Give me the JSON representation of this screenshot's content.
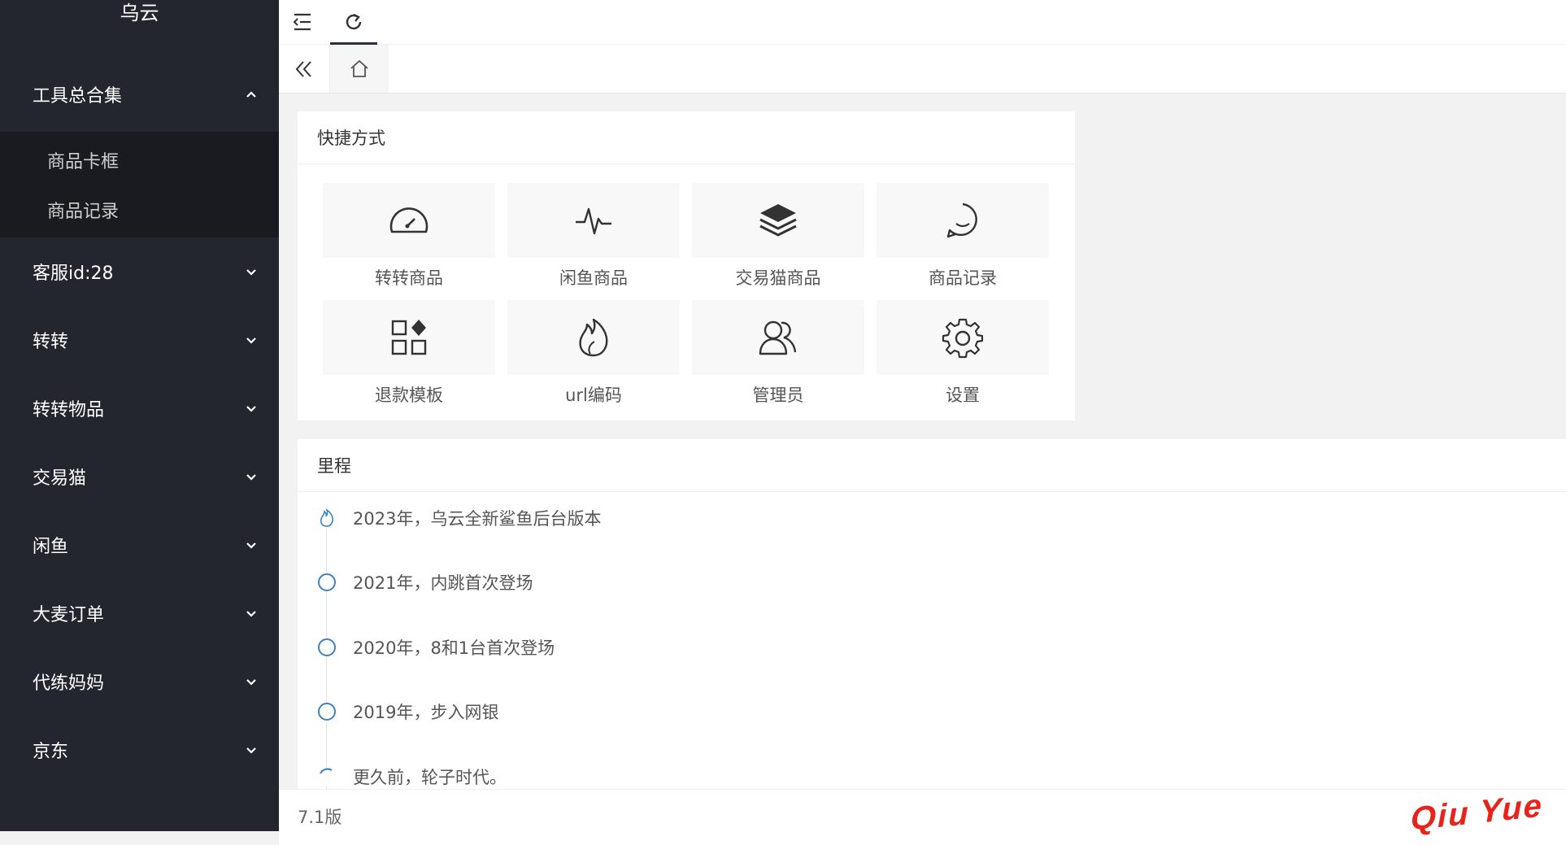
{
  "app": {
    "logo_text": "乌云"
  },
  "sidebar": {
    "groups": [
      {
        "label": "工具总合集",
        "expanded": true,
        "children": [
          "商品卡框",
          "商品记录"
        ]
      },
      {
        "label": "客服id:28",
        "expanded": false
      },
      {
        "label": "转转",
        "expanded": false
      },
      {
        "label": "转转物品",
        "expanded": false
      },
      {
        "label": "交易猫",
        "expanded": false
      },
      {
        "label": "闲鱼",
        "expanded": false
      },
      {
        "label": "大麦订单",
        "expanded": false
      },
      {
        "label": "代练妈妈",
        "expanded": false
      },
      {
        "label": "京东",
        "expanded": false
      }
    ]
  },
  "topbar": {
    "icons": [
      "menu-fold-icon",
      "refresh-icon"
    ]
  },
  "tabs": {
    "icons": [
      "double-chevron-left-icon",
      "home-icon"
    ]
  },
  "shortcuts": {
    "title": "快捷方式",
    "items": [
      {
        "label": "转转商品",
        "icon": "dashboard-gauge-icon"
      },
      {
        "label": "闲鱼商品",
        "icon": "heartbeat-pulse-icon"
      },
      {
        "label": "交易猫商品",
        "icon": "layers-stack-icon"
      },
      {
        "label": "商品记录",
        "icon": "smile-face-icon"
      },
      {
        "label": "退款模板",
        "icon": "app-grid-icon"
      },
      {
        "label": "url编码",
        "icon": "fire-flame-icon"
      },
      {
        "label": "管理员",
        "icon": "users-icon"
      },
      {
        "label": "设置",
        "icon": "gear-icon"
      }
    ]
  },
  "timeline": {
    "title": "里程",
    "items": [
      {
        "text": "2023年，乌云全新鲨鱼后台版本",
        "node": "flame"
      },
      {
        "text": "2021年，内跳首次登场",
        "node": "circle"
      },
      {
        "text": "2020年，8和1台首次登场",
        "node": "circle"
      },
      {
        "text": "2019年，步入网银",
        "node": "circle"
      },
      {
        "text": "更久前，轮子时代。",
        "node": "spinner"
      }
    ]
  },
  "footer": {
    "version": "7.1版",
    "brand": "Qiu Yue"
  },
  "colors": {
    "sidebar_bg": "#23262e",
    "submenu_bg": "#191b20",
    "brand_red": "#e8231a",
    "timeline_node": "#3b82c4"
  }
}
